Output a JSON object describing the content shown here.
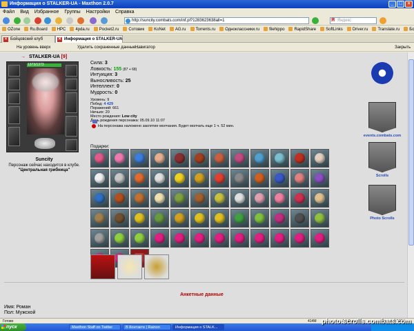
{
  "window": {
    "title": "Информация о STALKER-UA - Maxthon 2.0.7"
  },
  "menu": [
    "Файл",
    "Вид",
    "Избранное",
    "Группы",
    "Настройки",
    "Справка"
  ],
  "address": {
    "url": "http://suncity.combats.com/inf.pl?1283623638all=1"
  },
  "search": {
    "placeholder": "Яндекс"
  },
  "links": [
    "OZone",
    "Ru.Board",
    "HPC",
    "4pda.ru",
    "Pocket2.ru",
    "Сотовик",
    "KoNet",
    "AG.ru",
    "Torrents.ru",
    "Одноклассники.ru",
    "filehippo",
    "RapidShare",
    "SoftLinks",
    "Driver.ru",
    "Translate.ru",
    "Бойцовский клуб"
  ],
  "tabs": [
    {
      "label": "Бойцовский клуб",
      "active": false
    },
    {
      "label": "Информация о STALKER-UA",
      "active": true
    }
  ],
  "subbar": {
    "home": "На уровень вверх",
    "delete": "Удалить сохраненные данные...",
    "navigator": "Навигатор",
    "close": "Закрыть"
  },
  "character": {
    "name": "STALKER-UA",
    "level": "[9]",
    "hp": "1373/1373",
    "server": "Suncity",
    "location_text": "Персонаж сейчас находится в клубе.",
    "club": "\"Центральная грибница\""
  },
  "stats": {
    "strength_label": "Сила:",
    "strength": "3",
    "agility_label": "Ловкость:",
    "agility": "155",
    "agility_bonus": "(87 + 68)",
    "intuition_label": "Интуиция:",
    "intuition": "3",
    "endurance_label": "Выносливость:",
    "endurance": "25",
    "intellect_label": "Интеллект:",
    "intellect": "0",
    "wisdom_label": "Мудрость:",
    "wisdom": "0"
  },
  "info": {
    "levels": "Уровень: 9",
    "wins_label": "Побед:",
    "wins": "4 429",
    "losses": "Поражений: 661",
    "draws": "Ничьих: 20",
    "birthplace_label": "Место рождения:",
    "birthplace": "Low city",
    "birthday": "День рождения персонажа: 05.09.10 11:07"
  },
  "mute_text": "На персонажа наложено заклятие молчания. Будет молчать еще 1 ч. 52 мин.",
  "gifts_title": "Подарки:",
  "gifts": [
    {
      "c": "#e05a8a"
    },
    {
      "c": "#f07ab0"
    },
    {
      "c": "#3a7ee0"
    },
    {
      "c": "#e6b090"
    },
    {
      "c": "#8a3030"
    },
    {
      "c": "#a04020"
    },
    {
      "c": "#c86040"
    },
    {
      "c": "#c04c80"
    },
    {
      "c": "#50a0d0"
    },
    {
      "c": "#7cc0d0"
    },
    {
      "c": "#c03020"
    },
    {
      "c": "#e2d0c0"
    },
    {
      "c": "#f0f0f0"
    },
    {
      "c": "#c8c8c8"
    },
    {
      "c": "#e06a30"
    },
    {
      "c": "#e0e0e0"
    },
    {
      "c": "#f0d020"
    },
    {
      "c": "#d0a020"
    },
    {
      "c": "#e04030"
    },
    {
      "c": "#8a8a8a"
    },
    {
      "c": "#d06020"
    },
    {
      "c": "#3a58c8"
    },
    {
      "c": "#e08080"
    },
    {
      "c": "#8a50c0"
    },
    {
      "c": "#3070c0"
    },
    {
      "c": "#b05020"
    },
    {
      "c": "#c07030"
    },
    {
      "c": "#f0e0b0"
    },
    {
      "c": "#80a040"
    },
    {
      "c": "#a06030"
    },
    {
      "c": "#c8c040"
    },
    {
      "c": "#e0e0e0"
    },
    {
      "c": "#e0a0b0"
    },
    {
      "c": "#f080a0"
    },
    {
      "c": "#d03050"
    },
    {
      "c": "#e0c090"
    },
    {
      "c": "#a08050"
    },
    {
      "c": "#705030"
    },
    {
      "c": "#e0c020"
    },
    {
      "c": "#6a9a40"
    },
    {
      "c": "#d0a020"
    },
    {
      "c": "#e0c020"
    },
    {
      "c": "#e0c020"
    },
    {
      "c": "#40a040"
    },
    {
      "c": "#80c040"
    },
    {
      "c": "#c03080"
    },
    {
      "c": "#505050"
    },
    {
      "c": "#90c040"
    },
    {
      "c": "#a0a0a0"
    },
    {
      "c": "#90d040"
    },
    {
      "c": "#90d040"
    },
    {
      "c": "#e02080"
    },
    {
      "c": "#e02080"
    },
    {
      "c": "#e02080"
    },
    {
      "c": "#e02080"
    },
    {
      "c": "#e02080"
    },
    {
      "c": "#e02080"
    },
    {
      "c": "#e02080"
    },
    {
      "c": "#e02080"
    },
    {
      "c": "#e02080"
    },
    {
      "c": "#e02080"
    },
    {
      "c": "#e02080"
    },
    {
      "c": "#c06030",
      "dark": true
    }
  ],
  "right_links": {
    "events": "events.combats.com",
    "scrolls": "Scrolls",
    "photo_scrolls": "Photo Scrolls"
  },
  "section_title": "Анкетные данные",
  "anketa": {
    "name": "Имя: Роман",
    "sex": "Пол: Мужской"
  },
  "statusbar": {
    "left": "Готово",
    "mem": "414M",
    "adblock": "Ad-Охотник",
    "zoom": "Масштаб:100%"
  },
  "taskbar": {
    "start": "пуск",
    "tasks": [
      "Maxthon Staff on Twitter",
      "В Контакте | Rainon",
      "Информация о STALK..."
    ]
  },
  "watermark": "photo.scrolls.combats.com"
}
